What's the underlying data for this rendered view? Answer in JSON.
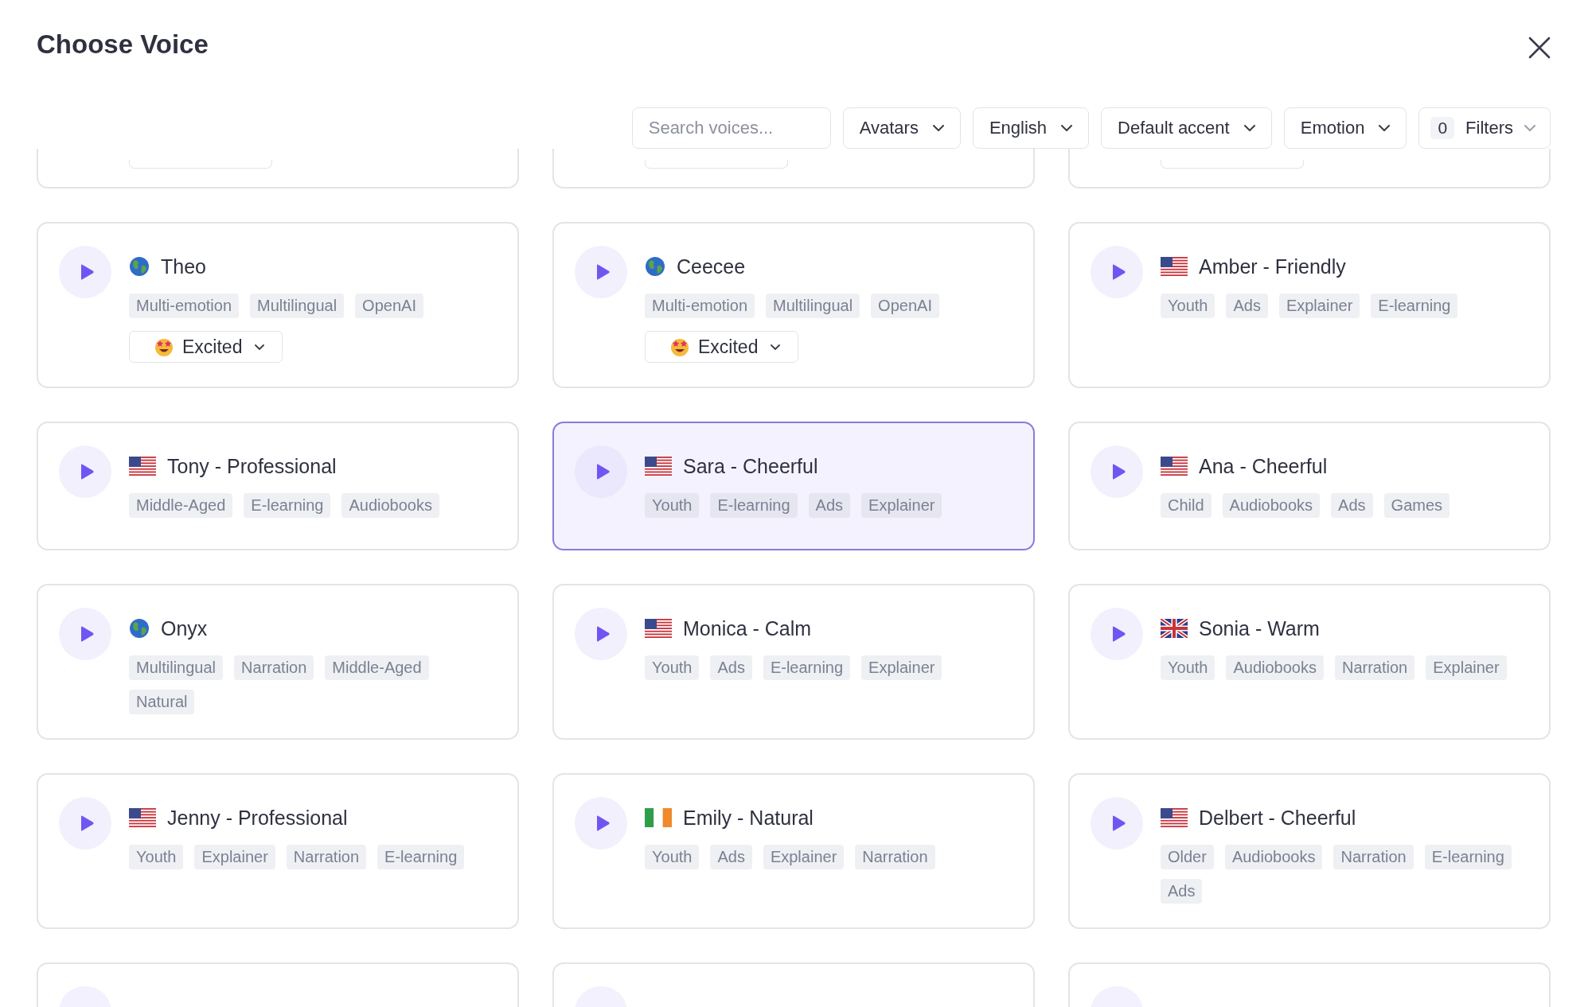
{
  "dialog": {
    "title": "Choose Voice"
  },
  "search": {
    "placeholder": "Search voices..."
  },
  "filters": [
    {
      "label": "Avatars"
    },
    {
      "label": "English"
    },
    {
      "label": "Default accent"
    },
    {
      "label": "Emotion"
    }
  ],
  "filter_count": {
    "count": "0",
    "label": "Filters"
  },
  "voices": [
    {
      "name": "Theo",
      "flag": {
        "kind": "globe"
      },
      "tags": [
        "Multi-emotion",
        "Multilingual",
        "OpenAI"
      ],
      "emotion": {
        "label": "Excited"
      },
      "selected": false
    },
    {
      "name": "Ceecee",
      "flag": {
        "kind": "globe"
      },
      "tags": [
        "Multi-emotion",
        "Multilingual",
        "OpenAI"
      ],
      "emotion": {
        "label": "Excited"
      },
      "selected": false
    },
    {
      "name": "Amber - Friendly",
      "flag": {
        "kind": "us"
      },
      "tags": [
        "Youth",
        "Ads",
        "Explainer",
        "E-learning"
      ],
      "selected": false
    },
    {
      "name": "Tony - Professional",
      "flag": {
        "kind": "us"
      },
      "tags": [
        "Middle-Aged",
        "E-learning",
        "Audiobooks"
      ],
      "selected": false
    },
    {
      "name": "Sara - Cheerful",
      "flag": {
        "kind": "us"
      },
      "tags": [
        "Youth",
        "E-learning",
        "Ads",
        "Explainer"
      ],
      "selected": true
    },
    {
      "name": "Ana - Cheerful",
      "flag": {
        "kind": "us"
      },
      "tags": [
        "Child",
        "Audiobooks",
        "Ads",
        "Games"
      ],
      "selected": false
    },
    {
      "name": "Onyx",
      "flag": {
        "kind": "globe"
      },
      "tags": [
        "Multilingual",
        "Narration",
        "Middle-Aged",
        "Natural"
      ],
      "selected": false
    },
    {
      "name": "Monica - Calm",
      "flag": {
        "kind": "us"
      },
      "tags": [
        "Youth",
        "Ads",
        "E-learning",
        "Explainer"
      ],
      "selected": false
    },
    {
      "name": "Sonia - Warm",
      "flag": {
        "kind": "uk"
      },
      "tags": [
        "Youth",
        "Audiobooks",
        "Narration",
        "Explainer"
      ],
      "selected": false
    },
    {
      "name": "Jenny - Professional",
      "flag": {
        "kind": "us"
      },
      "tags": [
        "Youth",
        "Explainer",
        "Narration",
        "E-learning"
      ],
      "selected": false
    },
    {
      "name": "Emily - Natural",
      "flag": {
        "kind": "ie"
      },
      "tags": [
        "Youth",
        "Ads",
        "Explainer",
        "Narration"
      ],
      "selected": false
    },
    {
      "name": "Delbert - Cheerful",
      "flag": {
        "kind": "us"
      },
      "tags": [
        "Older",
        "Audiobooks",
        "Narration",
        "E-learning",
        "Ads"
      ],
      "selected": false
    }
  ]
}
